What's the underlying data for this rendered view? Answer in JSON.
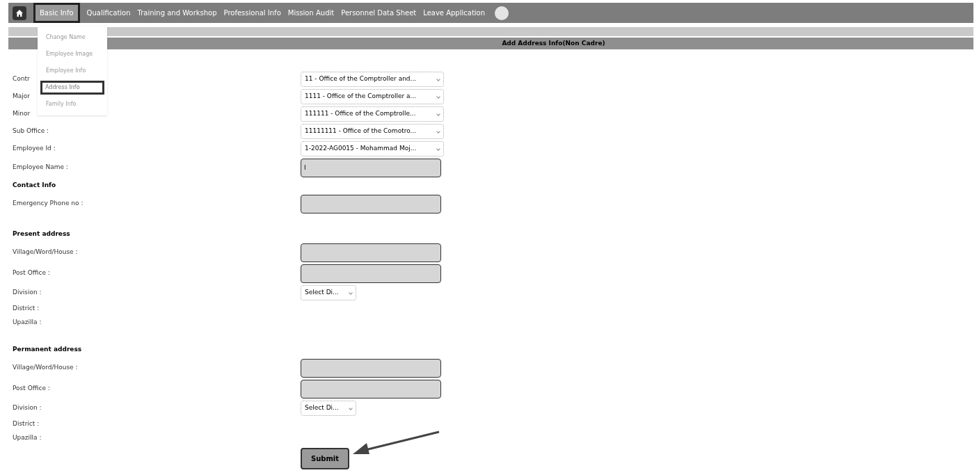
{
  "nav": {
    "items": [
      {
        "label": "Basic Info",
        "selected": true
      },
      {
        "label": "Qualification",
        "selected": false
      },
      {
        "label": "Training and Workshop",
        "selected": false
      },
      {
        "label": "Professional Info",
        "selected": false
      },
      {
        "label": "Mission Audit",
        "selected": false
      },
      {
        "label": "Personnel Data Sheet",
        "selected": false
      },
      {
        "label": "Leave Application",
        "selected": false
      }
    ]
  },
  "dropdown": {
    "items": [
      {
        "label": "Change Name",
        "selected": false
      },
      {
        "label": "Employee Image",
        "selected": false
      },
      {
        "label": "Employee Info",
        "selected": false
      },
      {
        "label": "Address Info",
        "selected": true
      },
      {
        "label": "Family Info",
        "selected": false
      }
    ]
  },
  "header": {
    "title": "Add Address Info(Non Cadre)"
  },
  "form": {
    "rows": [
      {
        "kind": "select",
        "label": "Contr",
        "value": "11 - Office of the Comptroller and..."
      },
      {
        "kind": "select",
        "label": "Major",
        "value": "1111 - Office of the Comptroller a..."
      },
      {
        "kind": "select",
        "label": "Minor",
        "value": "111111 - Office of the Comptrolle..."
      },
      {
        "kind": "select",
        "label": "Sub Office :",
        "value": "11111111 - Office of the Comotro..."
      },
      {
        "kind": "select",
        "label": "Employee Id :",
        "value": "1-2022-AG0015 - Mohammad Moj..."
      },
      {
        "kind": "input",
        "label": "Employee Name :",
        "value": "I"
      },
      {
        "kind": "heading",
        "label": "Contact Info"
      },
      {
        "kind": "input",
        "label": "Emergency Phone no :"
      },
      {
        "kind": "spacer"
      },
      {
        "kind": "heading",
        "label": "Present address"
      },
      {
        "kind": "input",
        "label": "Village/Word/House :"
      },
      {
        "kind": "input",
        "label": "Post Office :"
      },
      {
        "kind": "small-select",
        "label": "Division :",
        "value": "Select Di..."
      },
      {
        "kind": "label",
        "label": "District :"
      },
      {
        "kind": "label",
        "label": "Upazilla :"
      },
      {
        "kind": "spacer"
      },
      {
        "kind": "heading",
        "label": "Permanent address"
      },
      {
        "kind": "input",
        "label": "Village/Word/House :"
      },
      {
        "kind": "input",
        "label": "Post Office :"
      },
      {
        "kind": "small-select",
        "label": "Division :",
        "value": "Select Di..."
      },
      {
        "kind": "label",
        "label": "District :"
      },
      {
        "kind": "label",
        "label": "Upazilla :"
      }
    ],
    "submit": "Submit"
  }
}
